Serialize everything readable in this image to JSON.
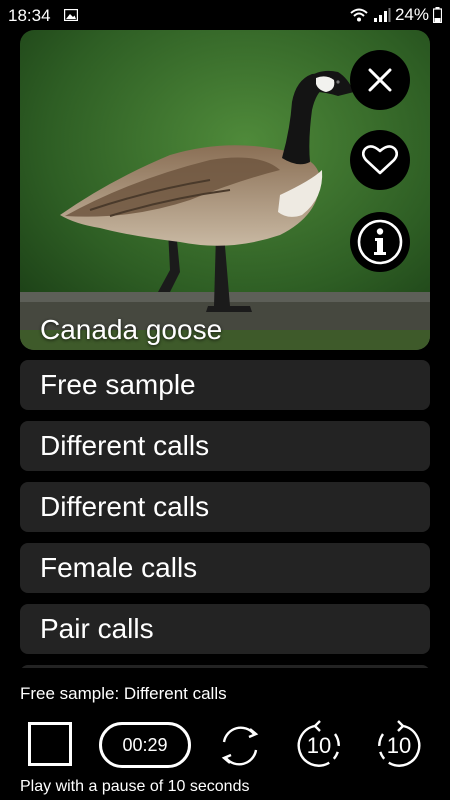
{
  "status_bar": {
    "time": "18:34",
    "battery": "24%"
  },
  "hero": {
    "title": "Canada goose"
  },
  "tracks": [
    {
      "label": "Free sample"
    },
    {
      "label": "Different calls"
    },
    {
      "label": "Different calls"
    },
    {
      "label": "Female calls"
    },
    {
      "label": "Pair calls"
    },
    {
      "label": ""
    }
  ],
  "player": {
    "now_playing": "Free sample: Different calls",
    "elapsed": "00:29",
    "skip_back_label": "10",
    "skip_forward_label": "10",
    "pause_note": "Play with a pause of 10 seconds"
  },
  "colors": {
    "background": "#000000",
    "list_item_bg": "#232323"
  },
  "icons": [
    "gallery-icon",
    "wifi-icon",
    "signal-icon",
    "battery-icon",
    "close-icon",
    "heart-icon",
    "info-icon",
    "stop-icon",
    "repeat-icon",
    "rewind-10-icon",
    "forward-10-icon"
  ]
}
